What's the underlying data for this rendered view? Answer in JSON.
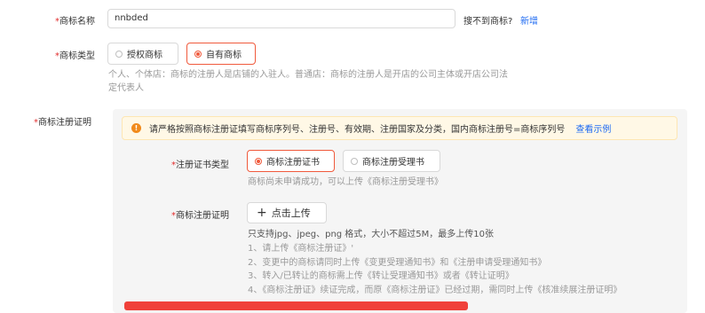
{
  "required_mark": "*",
  "brand_name": {
    "label": "商标名称",
    "value": "nnbded",
    "not_found_text": "搜不到商标?",
    "add_link": "新增"
  },
  "brand_type": {
    "label": "商标类型",
    "options": [
      {
        "label": "授权商标",
        "checked": false
      },
      {
        "label": "自有商标",
        "checked": true
      }
    ],
    "hint_line1": "个人、个体店：商标的注册人是店铺的入驻人。普通店：商标的注册人是开店的公司主体或开店公司法",
    "hint_line2": "定代表人"
  },
  "cert": {
    "label": "商标注册证明",
    "notice_text": "请严格按照商标注册证填写商标序列号、注册号、有效期、注册国家及分类，国内商标注册号=商标序列号",
    "notice_link": "查看示例",
    "cert_type_label": "注册证书类型",
    "cert_type_options": [
      {
        "label": "商标注册证书",
        "checked": true
      },
      {
        "label": "商标注册受理书",
        "checked": false
      }
    ],
    "cert_type_hint": "商标尚未申请成功，可以上传《商标注册受理书》",
    "upload_label": "商标注册证明",
    "upload_button": "点击上传",
    "upload_hints": [
      "只支持jpg、jpeg、png 格式，大小不超过5M，最多上传10张",
      "1、请上传《商标注册证》'",
      "2、变更中的商标请同时上传《变更受理通知书》和《注册申请受理通知书》",
      "3、转入/已转让的商标需上传《转让受理通知书》或者《转让证明》",
      "4、《商标注册证》续证完成，而原《商标注册证》已经过期，需同时上传《核准续展注册证明》"
    ]
  },
  "colors": {
    "accent": "#f05a3c",
    "link": "#1f6bf2",
    "warning": "#f18a1b",
    "required": "#e22c2c"
  }
}
